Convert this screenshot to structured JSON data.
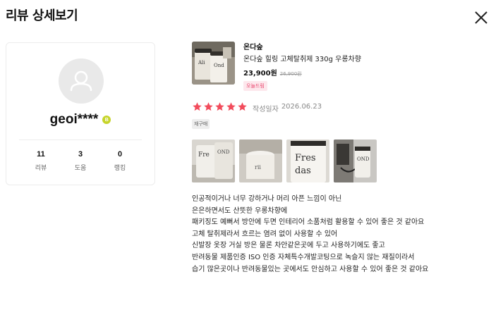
{
  "header": {
    "title": "리뷰 상세보기",
    "close_icon": "close-icon"
  },
  "profile": {
    "nickname": "geoi****",
    "grade_badge": "B",
    "stats": [
      {
        "value": "11",
        "label": "리뷰"
      },
      {
        "value": "3",
        "label": "도움"
      },
      {
        "value": "0",
        "label": "랭킹"
      }
    ]
  },
  "product": {
    "brand": "온다숲",
    "name": "온다숲 힐링 고체탈취제 330g 우롱차향",
    "price": "23,900원",
    "original_price": "26,900원",
    "store_tag": "오늘드림"
  },
  "review": {
    "rating": 5,
    "rating_max": 5,
    "date_label": "작성일자",
    "date": "2026.06.23",
    "tag": "재구매",
    "photo_count": 4,
    "lines": [
      "인공적이거나 너무 강하거나 머리 아픈 느낌이 아닌",
      "은은하면서도 산뜻한 우롱차향에",
      "패키징도 예뻐서 방안에 두면 인테리어 소품처럼 활용할 수 있어 좋은 것 같아요",
      "고체 탈취제라서 흐르는 염려 없이 사용할 수 있어",
      "신발장 옷장 거실 방은 물론 차안같은곳에 두고 사용하기에도 좋고",
      "반려동물 제품인증 ISO 인증 자체특수개발코팅으로 녹슬지 않는 재질이라서",
      "습기 많은곳이나 반려동물있는 곳에서도 안심하고 사용할 수 있어 좋은 것 같아요"
    ]
  },
  "colors": {
    "star": "#f24c5c",
    "store_tag_text": "#e9436b",
    "store_tag_bg": "#fde7ec",
    "grade_badge": "#c6d42a"
  }
}
